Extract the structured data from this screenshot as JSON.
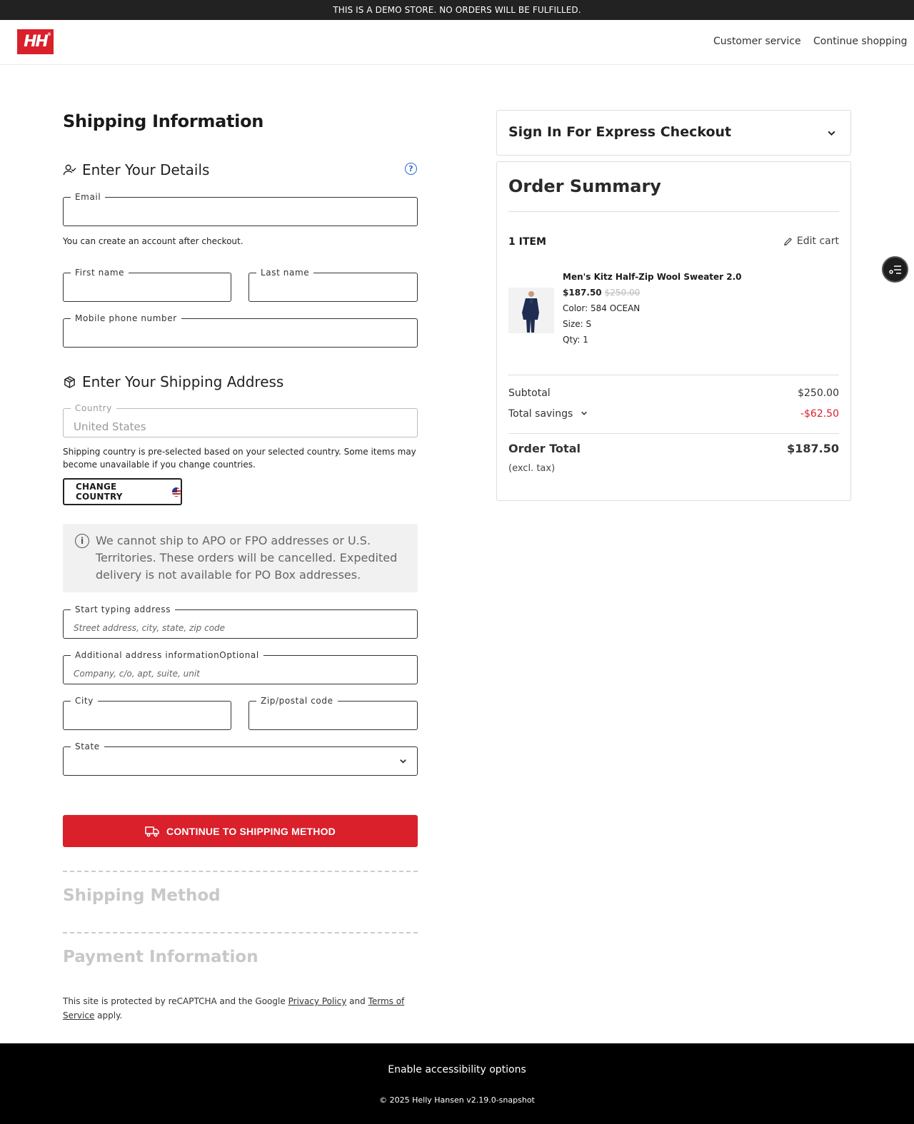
{
  "banner": {
    "text": "THIS IS A DEMO STORE. NO ORDERS WILL BE FULFILLED."
  },
  "header": {
    "logo_text": "HH",
    "customer_service": "Customer service",
    "continue_shopping": "Continue shopping"
  },
  "shipping": {
    "title": "Shipping Information",
    "details_heading": "Enter Your Details",
    "email_label": "Email",
    "email_value": "",
    "account_hint": "You can create an account after checkout.",
    "first_name_label": "First name",
    "last_name_label": "Last name",
    "mobile_label": "Mobile phone number",
    "address_heading": "Enter Your Shipping Address",
    "country_label": "Country",
    "country_value": "United States",
    "country_hint": "Shipping country is pre-selected based on your selected country. Some items may become unavailable if you change countries.",
    "change_country": "CHANGE COUNTRY",
    "notice": "We cannot ship to APO or FPO addresses or U.S. Territories. These orders will be cancelled. Expedited delivery is not available for PO Box addresses.",
    "address_label": "Start typing address",
    "address_placeholder": "Street address, city, state, zip code",
    "additional_label": "Additional address informationOptional",
    "additional_placeholder": "Company, c/o, apt, suite, unit",
    "city_label": "City",
    "zip_label": "Zip/postal code",
    "state_label": "State",
    "state_value": "",
    "continue_button": "CONTINUE TO SHIPPING METHOD"
  },
  "steps": {
    "shipping_method": "Shipping Method",
    "payment_information": "Payment Information"
  },
  "recaptcha": {
    "prefix": "This site is protected by reCAPTCHA and the Google ",
    "privacy": "Privacy Policy",
    "and": " and ",
    "terms": "Terms of Service",
    "suffix": " apply."
  },
  "express": {
    "title": "Sign In For Express Checkout"
  },
  "summary": {
    "title": "Order Summary",
    "items_count": "1 ITEM",
    "edit_cart": "Edit cart",
    "product": {
      "name": "Men's Kitz Half-Zip Wool Sweater 2.0",
      "price": "$187.50",
      "original_price": "$250.00",
      "color": "Color: 584 OCEAN",
      "size": "Size: S",
      "qty": "Qty: 1"
    },
    "subtotal_label": "Subtotal",
    "subtotal_value": "$250.00",
    "savings_label": "Total savings",
    "savings_value": "-$62.50",
    "total_label": "Order Total",
    "total_value": "$187.50",
    "tax_note": "(excl. tax)"
  },
  "footer": {
    "accessibility": "Enable accessibility options",
    "copyright": "© 2025 Helly Hansen v2.19.0-snapshot"
  },
  "colors": {
    "brand_red": "#d9202b",
    "help_blue": "#2b6ad8"
  }
}
